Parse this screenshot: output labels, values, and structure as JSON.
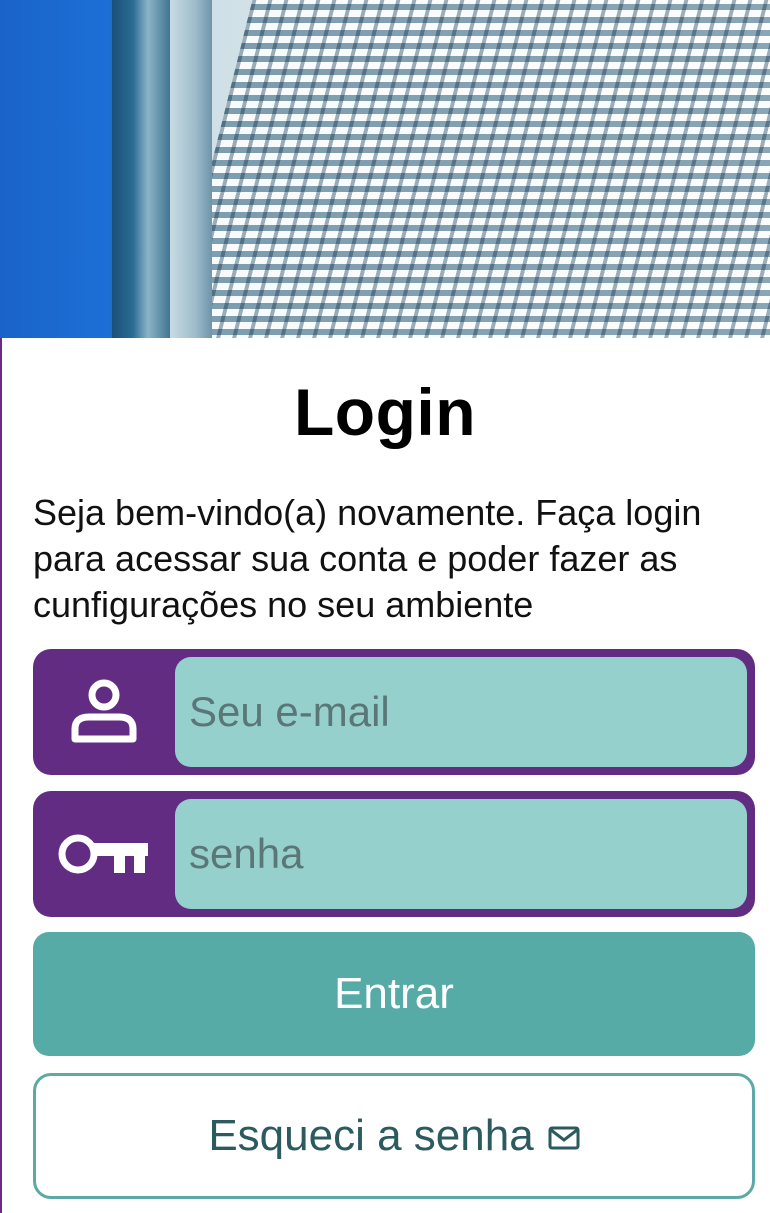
{
  "login": {
    "title": "Login",
    "intro": "Seja bem-vindo(a) novamente. Faça login para acessar sua conta e poder fazer as cunfigurações no seu ambiente",
    "email": {
      "value": "",
      "placeholder": "Seu e-mail",
      "icon": "user-icon"
    },
    "password": {
      "value": "",
      "placeholder": "senha",
      "icon": "key-icon"
    },
    "submit_label": "Entrar",
    "forgot_label": "Esqueci a senha",
    "forgot_icon": "mail-icon"
  },
  "colors": {
    "brand_purple": "#622c83",
    "input_bg": "#96d0cd",
    "primary_button": "#57aba6",
    "outline_border": "#5ea9a6"
  }
}
